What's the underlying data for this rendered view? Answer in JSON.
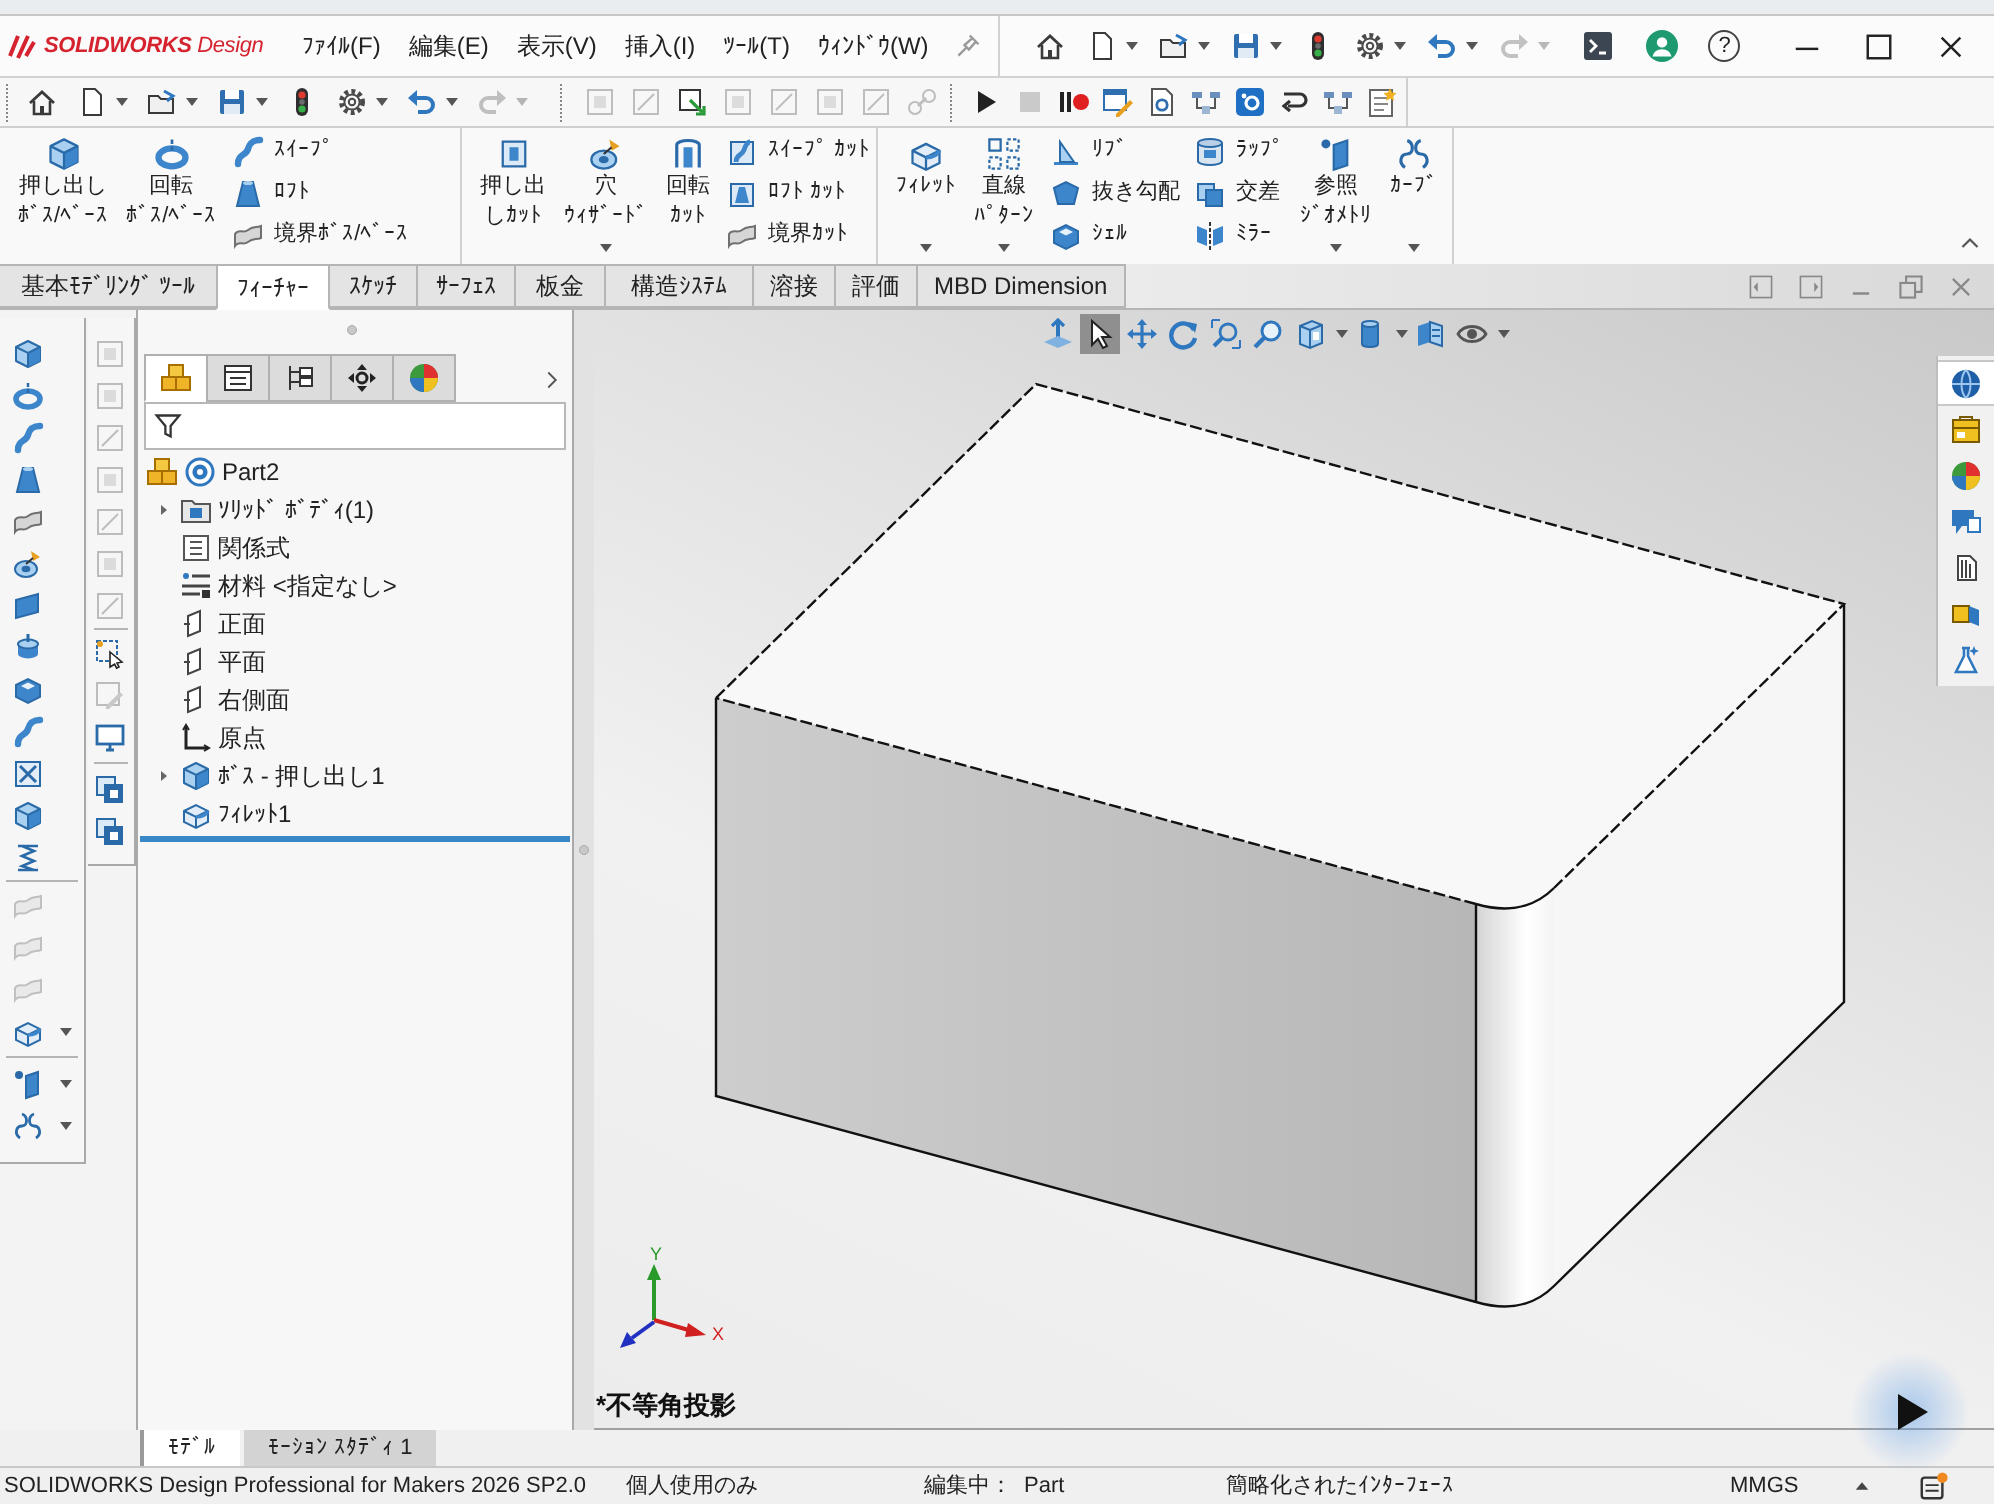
{
  "title_bar": {
    "logo": "**SOLIDWORKS** Design",
    "menu": [
      "ﾌｧｲﾙ(F)",
      "編集(E)",
      "表示(V)",
      "挿入(I)",
      "ﾂｰﾙ(T)",
      "ｳｨﾝﾄﾞｳ(W)"
    ],
    "toolbar": [
      {
        "disabled": false
      },
      {
        "disabled": false
      },
      {
        "disabled": false
      },
      {
        "disabled": false
      },
      {
        "disabled": false
      },
      {
        "disabled": false
      },
      {
        "disabled": false
      },
      {
        "disabled": true
      }
    ],
    "help": "?"
  },
  "standard_toolbar": [
    {
      "disabled": false
    },
    {
      "disabled": false
    },
    {
      "disabled": false
    },
    {
      "disabled": false
    },
    {
      "disabled": false
    },
    {
      "disabled": false
    },
    {
      "disabled": false
    },
    {
      "disabled": true
    }
  ],
  "sketch_toolbar": [
    {
      "disabled": true
    },
    {
      "disabled": true
    },
    {
      "disabled": false
    },
    {
      "disabled": true
    },
    {
      "disabled": true
    },
    {
      "disabled": true
    },
    {
      "disabled": true
    },
    {
      "disabled": true
    }
  ],
  "macro_toolbar": [
    {
      "disabled": false
    },
    {
      "disabled": true
    },
    {
      "disabled": false
    },
    {
      "disabled": false
    },
    {
      "disabled": false
    },
    {
      "disabled": false
    },
    {
      "disabled": false
    },
    {
      "disabled": false
    },
    {
      "disabled": false
    },
    {
      "disabled": false
    }
  ],
  "command_manager": {
    "groups": [
      {
        "items": [
          {
            "kind": "large",
            "lines": [
              "押し出し",
              "ﾎﾞｽ/ﾍﾞｰｽ"
            ],
            "dropdown": false
          },
          {
            "kind": "large",
            "lines": [
              "回転",
              "ﾎﾞｽ/ﾍﾞｰｽ"
            ],
            "dropdown": false
          },
          {
            "kind": "stack",
            "items": [
              {
                "label": "ｽｲｰﾌﾟ"
              },
              {
                "label": "ﾛﾌﾄ"
              },
              {
                "label": "境界ﾎﾞｽ/ﾍﾞｰｽ"
              }
            ]
          }
        ]
      },
      {
        "items": [
          {
            "kind": "large",
            "lines": [
              "押し出",
              "しｶｯﾄ"
            ],
            "dropdown": false
          },
          {
            "kind": "large",
            "lines": [
              "穴",
              "ｳｨｻﾞｰﾄﾞ"
            ],
            "dropdown": true
          },
          {
            "kind": "large",
            "lines": [
              "回転",
              "ｶｯﾄ"
            ],
            "dropdown": false
          },
          {
            "kind": "stack",
            "items": [
              {
                "label": "ｽｲｰﾌﾟ ｶｯﾄ"
              },
              {
                "label": "ﾛﾌﾄ ｶｯﾄ"
              },
              {
                "label": "境界ｶｯﾄ"
              }
            ]
          }
        ]
      },
      {
        "items": [
          {
            "kind": "large",
            "lines": [
              "ﾌｨﾚｯﾄ"
            ],
            "dropdown": true
          },
          {
            "kind": "large",
            "lines": [
              "直線",
              "ﾊﾟﾀｰﾝ"
            ],
            "dropdown": true
          },
          {
            "kind": "stack",
            "items": [
              {
                "label": "ﾘﾌﾞ"
              },
              {
                "label": "抜き勾配"
              },
              {
                "label": "ｼｪﾙ"
              }
            ]
          },
          {
            "kind": "stack",
            "items": [
              {
                "label": "ﾗｯﾌﾟ"
              },
              {
                "label": "交差"
              },
              {
                "label": "ﾐﾗｰ"
              }
            ]
          },
          {
            "kind": "large",
            "lines": [
              "参照",
              "ｼﾞｵﾒﾄﾘ"
            ],
            "dropdown": true
          },
          {
            "kind": "large",
            "lines": [
              "ｶｰﾌﾞ"
            ],
            "dropdown": true
          }
        ]
      }
    ]
  },
  "tabs": [
    {
      "label": "基本ﾓﾃﾞﾘﾝｸﾞ ﾂｰﾙ",
      "selected": false
    },
    {
      "label": "ﾌｨｰﾁｬｰ",
      "selected": true
    },
    {
      "label": "ｽｹｯﾁ",
      "selected": false
    },
    {
      "label": "ｻｰﾌｪｽ",
      "selected": false
    },
    {
      "label": "板金",
      "selected": false
    },
    {
      "label": "構造ｼｽﾃﾑ",
      "selected": false
    },
    {
      "label": "溶接",
      "selected": false
    },
    {
      "label": "評価",
      "selected": false
    },
    {
      "label": "MBD Dimension",
      "selected": false
    }
  ],
  "left_toolbar": [
    {
      "disabled": false
    },
    {
      "disabled": false
    },
    {
      "disabled": false
    },
    {
      "disabled": false
    },
    {
      "disabled": false
    },
    {
      "disabled": false
    },
    {
      "disabled": false
    },
    {
      "disabled": false
    },
    {
      "disabled": false
    },
    {
      "disabled": false
    },
    {
      "disabled": false
    },
    {
      "disabled": false
    },
    {
      "disabled": false
    },
    {
      "disabled": true
    },
    {
      "disabled": true
    },
    {
      "disabled": true
    },
    {
      "disabled": false
    },
    {
      "disabled": false
    },
    {
      "disabled": false
    }
  ],
  "side_toolbar": [
    {
      "disabled": true
    },
    {
      "disabled": true
    },
    {
      "disabled": true
    },
    {
      "disabled": true
    },
    {
      "disabled": true
    },
    {
      "disabled": true
    },
    {
      "disabled": true
    },
    {
      "disabled": false
    },
    {
      "disabled": true
    },
    {
      "disabled": false
    },
    {
      "disabled": false
    },
    {
      "disabled": false
    }
  ],
  "feature_manager": {
    "tabs": [
      {
        "selected": true
      },
      {
        "selected": false
      },
      {
        "selected": false
      },
      {
        "selected": false
      },
      {
        "selected": false
      }
    ],
    "tree": [
      {
        "kind": "part",
        "label": "Part2",
        "children": [
          {
            "kind": "folder",
            "label": "ｿﾘｯﾄﾞ ﾎﾞﾃﾞｨ(1)",
            "expanded": false
          },
          {
            "kind": "equations",
            "label": "関係式"
          },
          {
            "kind": "material",
            "label": "材料 <指定なし>"
          },
          {
            "kind": "plane",
            "label": "正面"
          },
          {
            "kind": "plane",
            "label": "平面"
          },
          {
            "kind": "plane",
            "label": "右側面"
          },
          {
            "kind": "origin",
            "label": "原点"
          },
          {
            "kind": "extrude",
            "label": "ﾎﾞｽ - 押し出し1",
            "expanded": false
          },
          {
            "kind": "fillet",
            "label": "ﾌｨﾚｯﾄ1"
          }
        ]
      }
    ]
  },
  "bottom_tabs": [
    {
      "label": "ﾓﾃﾞﾙ",
      "selected": true
    },
    {
      "label": "ﾓｰｼｮﾝ ｽﾀﾃﾞｨ 1",
      "selected": false
    }
  ],
  "graphics": {
    "view_toolbar": [
      {
        "selected": false
      },
      {
        "selected": true
      },
      {
        "selected": false
      },
      {
        "selected": false
      },
      {
        "selected": false
      },
      {
        "selected": false
      },
      {
        "selected": false
      },
      {
        "selected": false
      },
      {
        "selected": false
      },
      {
        "selected": false
      }
    ],
    "task_pane": [
      {
        "selected": true
      },
      {
        "selected": false
      },
      {
        "selected": false
      },
      {
        "selected": false
      },
      {
        "selected": false
      },
      {
        "selected": false
      },
      {
        "selected": false
      }
    ],
    "view_name": "*不等角投影",
    "triad": {
      "y": "Y",
      "x": "X"
    }
  },
  "status_bar": {
    "product": "SOLIDWORKS Design Professional for Makers 2026 SP2.0",
    "license": "個人使用のみ",
    "editing_label": "編集中：",
    "document": "Part",
    "interface": "簡略化されたｲﾝﾀｰﾌｪｰｽ",
    "units": "MMGS"
  }
}
